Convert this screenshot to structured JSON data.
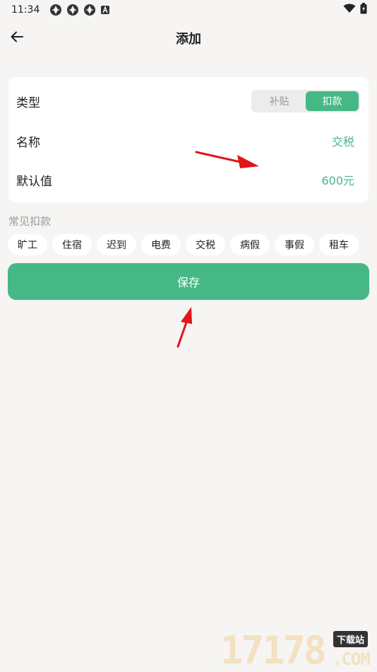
{
  "status_bar": {
    "time": "11:34",
    "left_icons": [
      "notification-icon",
      "notification-icon",
      "notification-icon",
      "app-a-icon"
    ],
    "right_icons": [
      "wifi-icon",
      "battery-icon"
    ]
  },
  "app_bar": {
    "title": "添加",
    "back_icon": "arrow-left-icon"
  },
  "form": {
    "type": {
      "label": "类型",
      "options": [
        "补贴",
        "扣款"
      ],
      "selected": "扣款"
    },
    "name": {
      "label": "名称",
      "value": "交税"
    },
    "default_value": {
      "label": "默认值",
      "value": "600元"
    }
  },
  "common": {
    "title": "常见扣款",
    "chips": [
      "旷工",
      "住宿",
      "迟到",
      "电费",
      "交税",
      "病假",
      "事假",
      "租车"
    ]
  },
  "save_label": "保存",
  "watermark": {
    "number": "17178",
    "tag": "下载站",
    "domain": ".COM"
  },
  "colors": {
    "accent": "#46b886",
    "background": "#f6f5f3",
    "annotation": "#e0161b"
  }
}
